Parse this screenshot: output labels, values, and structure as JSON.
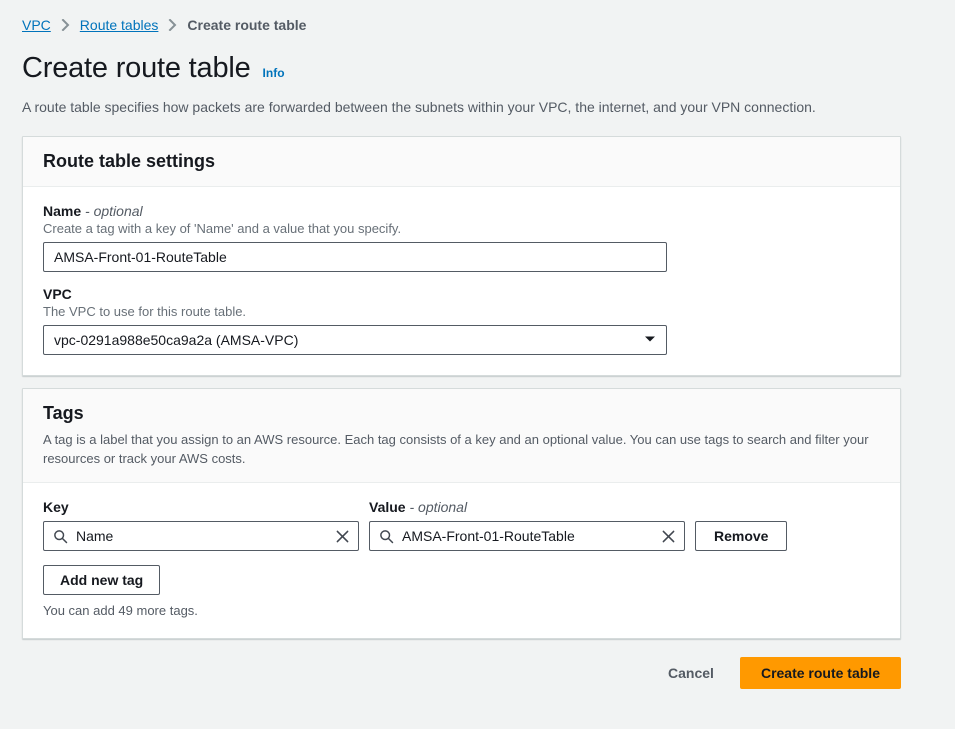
{
  "breadcrumb": {
    "items": [
      {
        "label": "VPC",
        "type": "link"
      },
      {
        "label": "Route tables",
        "type": "link"
      },
      {
        "label": "Create route table",
        "type": "current"
      }
    ],
    "separator_icon": "chevron-right-icon"
  },
  "header": {
    "title": "Create route table",
    "info_label": "Info",
    "description": "A route table specifies how packets are forwarded between the subnets within your VPC, the internet, and your VPN connection."
  },
  "settings_panel": {
    "title": "Route table settings",
    "name_field": {
      "label": "Name",
      "optional_suffix": "- optional",
      "hint": "Create a tag with a key of 'Name' and a value that you specify.",
      "value": "AMSA-Front-01-RouteTable",
      "placeholder": ""
    },
    "vpc_field": {
      "label": "VPC",
      "hint": "The VPC to use for this route table.",
      "value": "vpc-0291a988e50ca9a2a (AMSA-VPC)",
      "caret_icon": "chevron-down-icon"
    }
  },
  "tags_panel": {
    "title": "Tags",
    "description": "A tag is a label that you assign to an AWS resource. Each tag consists of a key and an optional value. You can use tags to search and filter your resources or track your AWS costs.",
    "key_column_label": "Key",
    "value_column_label": "Value",
    "value_optional_suffix": "- optional",
    "rows": [
      {
        "key": "Name",
        "value": "AMSA-Front-01-RouteTable",
        "remove_label": "Remove",
        "search_icon": "search-icon",
        "clear_icon": "close-icon"
      }
    ],
    "add_tag_label": "Add new tag",
    "remaining_note": "You can add 49 more tags."
  },
  "actions": {
    "cancel_label": "Cancel",
    "submit_label": "Create route table"
  },
  "colors": {
    "page_background": "#f1f3f3",
    "panel_background": "#ffffff",
    "panel_header_background": "#fafafa",
    "link": "#0073bb",
    "primary_button": "#ff9900",
    "border": "#d5dbdb",
    "input_border": "#545b64",
    "secondary_text": "#545b64"
  }
}
